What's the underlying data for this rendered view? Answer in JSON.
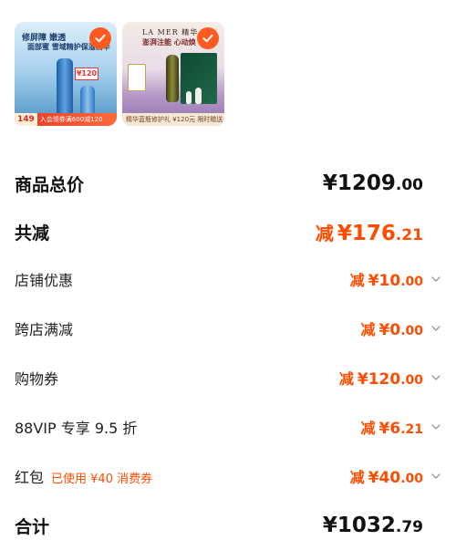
{
  "products": [
    {
      "name": "product-1",
      "headline": "修屏障  嫩透",
      "subline": "面部蜜 雪域精护保湿精华",
      "tag": "¥120",
      "price_chip": "149",
      "bar_text": "入会领券满600减120",
      "selected": true
    },
    {
      "name": "product-2",
      "brand": "LA MER 精华",
      "headline": "澎湃注能 心动焕",
      "bar_text": "精华蓝瓶修护礼 ¥120元  限时赠送",
      "selected": true
    }
  ],
  "summary": {
    "total_label": "商品总价",
    "total_currency": "¥",
    "total_int": "1209",
    "total_dec": ".00",
    "reduce_label": "共减",
    "reduce_prefix": "减",
    "reduce_currency": "¥",
    "reduce_int": "176",
    "reduce_dec": ".21",
    "items": [
      {
        "label": "店铺优惠",
        "prefix": "减",
        "currency": "¥",
        "int": "10",
        "dec": ".00"
      },
      {
        "label": "跨店满减",
        "prefix": "减",
        "currency": "¥",
        "int": "0",
        "dec": ".00"
      },
      {
        "label": "购物券",
        "prefix": "减",
        "currency": "¥",
        "int": "120",
        "dec": ".00"
      },
      {
        "label": "88VIP 专享 9.5 折",
        "prefix": "减",
        "currency": "¥",
        "int": "6",
        "dec": ".21"
      },
      {
        "label": "红包",
        "note": "已使用 ¥40 消费券",
        "prefix": "减",
        "currency": "¥",
        "int": "40",
        "dec": ".00"
      }
    ],
    "final_label": "合计",
    "final_currency": "¥",
    "final_int": "1032",
    "final_dec": ".79"
  },
  "colors": {
    "accent": "#ff4d00",
    "check": "#ff5a1f",
    "text": "#111111"
  }
}
